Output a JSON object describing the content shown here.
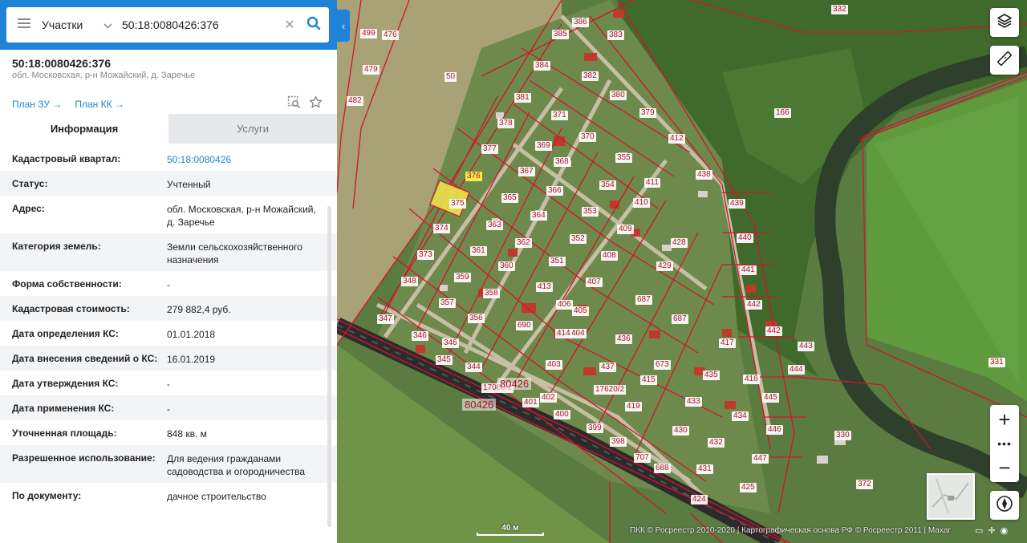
{
  "search": {
    "category": "Участки",
    "value": "50:18:0080426:376"
  },
  "parcel": {
    "cadastral_number": "50:18:0080426:376",
    "address": "обл. Московская, р-н Можайский, д. Заречье",
    "links": [
      "План ЗУ →",
      "План КК →"
    ]
  },
  "tabs": [
    "Информация",
    "Услуги"
  ],
  "info_rows": [
    {
      "key": "Кадастровый квартал:",
      "value": "50:18:0080426",
      "link": true
    },
    {
      "key": "Статус:",
      "value": "Учтенный"
    },
    {
      "key": "Адрес:",
      "value": "обл. Московская, р-н Можайский, д. Заречье"
    },
    {
      "key": "Категория земель:",
      "value": "Земли сельскохозяйственного назначения"
    },
    {
      "key": "Форма собственности:",
      "value": "-"
    },
    {
      "key": "Кадастровая стоимость:",
      "value": "279 882,4 руб."
    },
    {
      "key": "Дата определения КС:",
      "value": "01.01.2018"
    },
    {
      "key": "Дата внесения сведений о КС:",
      "value": "16.01.2019"
    },
    {
      "key": "Дата утверждения КС:",
      "value": "-"
    },
    {
      "key": "Дата применения КС:",
      "value": "-"
    },
    {
      "key": "Уточненная площадь:",
      "value": "848 кв. м"
    },
    {
      "key": "Разрешенное использование:",
      "value": "Для ведения гражданами садоводства и огородничества"
    },
    {
      "key": "По документу:",
      "value": "дачное строительство"
    }
  ],
  "map": {
    "plot_labels": [
      "499",
      "476",
      "479",
      "482",
      "50",
      "384",
      "385",
      "386",
      "383",
      "382",
      "380",
      "381",
      "379",
      "378",
      "377",
      "376",
      "375",
      "374",
      "373",
      "348",
      "347",
      "346",
      "346",
      "345",
      "344",
      "17080/2",
      "80426",
      "80426",
      "372",
      "371",
      "370",
      "369",
      "368",
      "367",
      "366",
      "365",
      "364",
      "363",
      "362",
      "361",
      "360",
      "359",
      "358",
      "357",
      "356",
      "355",
      "354",
      "353",
      "352",
      "351",
      "413",
      "412",
      "411",
      "410",
      "409",
      "408",
      "407",
      "406",
      "405",
      "404",
      "403",
      "402",
      "401",
      "400",
      "399",
      "398",
      "707",
      "688",
      "690",
      "687",
      "687",
      "436",
      "437",
      "438",
      "439",
      "440",
      "441",
      "442",
      "442",
      "443",
      "444",
      "445",
      "446",
      "447",
      "425",
      "424",
      "428",
      "429",
      "430",
      "431",
      "432",
      "433",
      "434",
      "435",
      "417",
      "416",
      "415",
      "414",
      "419",
      "17620/2",
      "673",
      "166",
      "330",
      "331",
      "332"
    ],
    "selected_label": "376",
    "scale_text": "40 м",
    "attribution": "ПКК © Росреестр 2010-2020 | Картографическая основа РФ © Росреестр 2011 | Maxar",
    "colors": {
      "boundary": "#d2142d",
      "selected_fill": "#f3e94a",
      "accent": "#1f84d7"
    }
  }
}
